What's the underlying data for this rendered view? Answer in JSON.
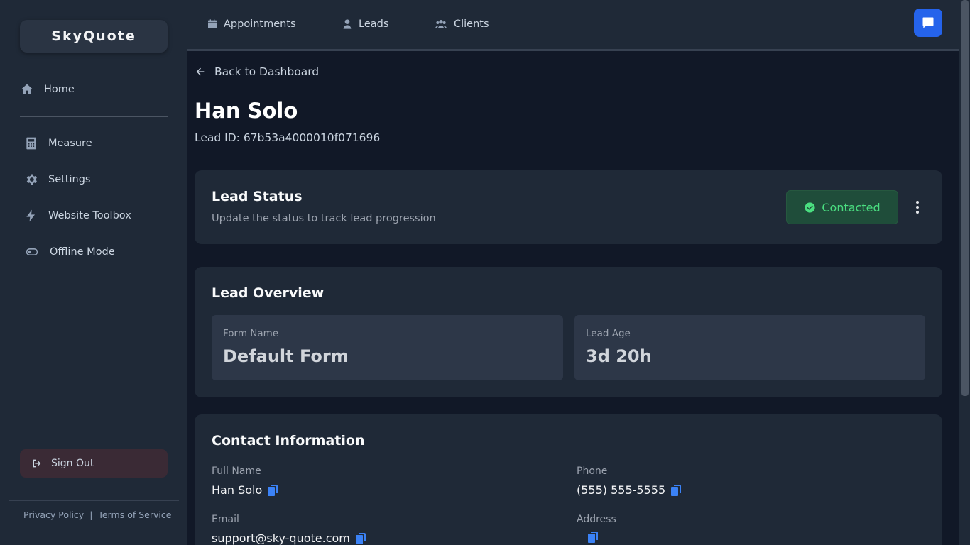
{
  "brand": {
    "logo_text": "SkyQuote"
  },
  "sidebar": {
    "items": [
      {
        "label": "Home",
        "icon": "home-icon"
      },
      {
        "label": "Measure",
        "icon": "calculator-icon"
      },
      {
        "label": "Settings",
        "icon": "gear-icon"
      },
      {
        "label": "Website Toolbox",
        "icon": "bolt-icon"
      },
      {
        "label": "Offline Mode",
        "icon": "toggle-icon"
      }
    ],
    "sign_out": "Sign Out",
    "footer": {
      "privacy": "Privacy Policy",
      "separator": "|",
      "terms": "Terms of Service"
    }
  },
  "topnav": {
    "tabs": [
      {
        "label": "Appointments",
        "icon": "calendar-icon"
      },
      {
        "label": "Leads",
        "icon": "user-icon"
      },
      {
        "label": "Clients",
        "icon": "users-icon"
      }
    ],
    "chat_icon": "chat-icon"
  },
  "main": {
    "back_label": "Back to Dashboard",
    "title": "Han Solo",
    "lead_id": "Lead ID: 67b53a4000010f071696"
  },
  "status_card": {
    "title": "Lead Status",
    "subtitle": "Update the status to track lead progression",
    "status": "Contacted",
    "status_color": "#4ade80"
  },
  "overview_card": {
    "title": "Lead Overview",
    "form_name_label": "Form Name",
    "form_name_value": "Default Form",
    "lead_age_label": "Lead Age",
    "lead_age_value": "3d 20h"
  },
  "contact_card": {
    "title": "Contact Information",
    "full_name_label": "Full Name",
    "full_name": "Han Solo",
    "phone_label": "Phone",
    "phone": "(555) 555-5555",
    "email_label": "Email",
    "email": "support@sky-quote.com",
    "address_label": "Address",
    "address": ""
  },
  "colors": {
    "accent": "#2563eb",
    "sidebar_bg": "#1f2937",
    "page_bg": "#111827"
  }
}
